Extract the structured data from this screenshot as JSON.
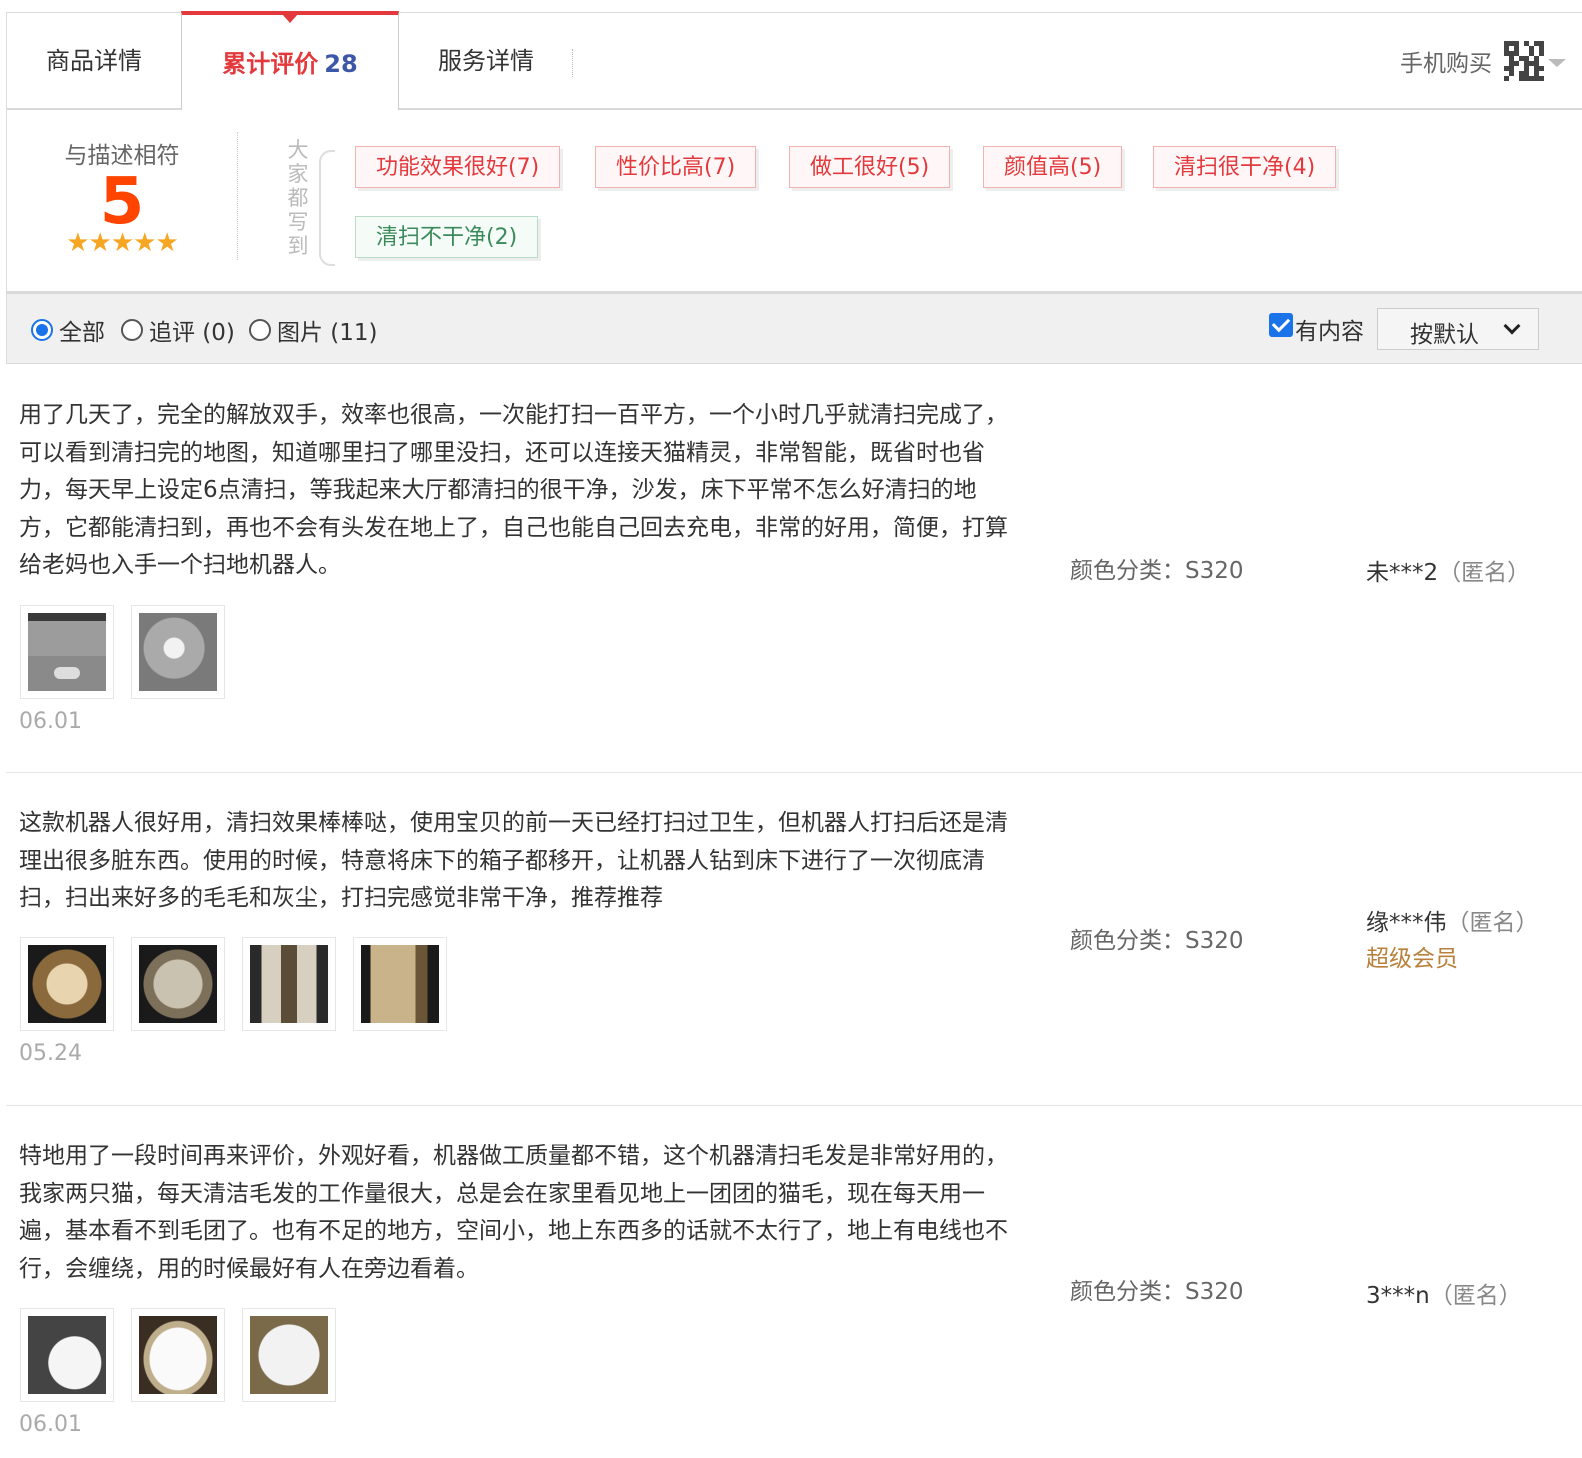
{
  "tabs": [
    {
      "label": "商品详情"
    },
    {
      "label": "累计评价",
      "count": "28"
    },
    {
      "label": "服务详情"
    }
  ],
  "mobile_buy": {
    "label": "手机购买",
    "icon": "qr-code-icon"
  },
  "rating": {
    "label": "与描述相符",
    "score": "5",
    "stars": "★★★★★",
    "everyone_wrote": "大家都写到"
  },
  "tags": [
    {
      "text": "功能效果很好(7)",
      "sentiment": "positive"
    },
    {
      "text": "性价比高(7)",
      "sentiment": "positive"
    },
    {
      "text": "做工很好(5)",
      "sentiment": "positive"
    },
    {
      "text": "颜值高(5)",
      "sentiment": "positive"
    },
    {
      "text": "清扫很干净(4)",
      "sentiment": "positive"
    },
    {
      "text": "清扫不干净(2)",
      "sentiment": "negative"
    }
  ],
  "filter": {
    "options": [
      {
        "label": "全部",
        "selected": true
      },
      {
        "label": "追评 (0)",
        "selected": false
      },
      {
        "label": "图片 (11)",
        "selected": false
      }
    ],
    "has_content": {
      "label": "有内容",
      "checked": true
    },
    "sort": {
      "label": "按默认"
    }
  },
  "reviews": [
    {
      "text": "用了几天了，完全的解放双手，效率也很高，一次能打扫一百平方，一个小时几乎就清扫完成了，可以看到清扫完的地图，知道哪里扫了哪里没扫，还可以连接天猫精灵，非常智能，既省时也省力，每天早上设定6点清扫，等我起来大厅都清扫的很干净，沙发，床下平常不怎么好清扫的地方，它都能清扫到，再也不会有头发在地上了，自己也能自己回去充电，非常的好用，简便，打算给老妈也入手一个扫地机器人。",
      "images": 2,
      "date": "06.01",
      "sku": "颜色分类：S320",
      "user": "未***2",
      "anon": "（匿名）"
    },
    {
      "text": "这款机器人很好用，清扫效果棒棒哒，使用宝贝的前一天已经打扫过卫生，但机器人打扫后还是清理出很多脏东西。使用的时候，特意将床下的箱子都移开，让机器人钻到床下进行了一次彻底清扫，扫出来好多的毛毛和灰尘，打扫完感觉非常干净，推荐推荐",
      "images": 4,
      "date": "05.24",
      "sku": "颜色分类：S320",
      "user": "缘***伟",
      "anon": "（匿名）",
      "vip": "超级会员"
    },
    {
      "text": "特地用了一段时间再来评价，外观好看，机器做工质量都不错，这个机器清扫毛发是非常好用的，我家两只猫，每天清洁毛发的工作量很大，总是会在家里看见地上一团团的猫毛，现在每天用一遍，基本看不到毛团了。也有不足的地方，空间小，地上东西多的话就不太行了，地上有电线也不行，会缠绕，用的时候最好有人在旁边看着。",
      "images": 3,
      "date": "06.01",
      "sku": "颜色分类：S320",
      "user": "3***n",
      "anon": "（匿名）"
    }
  ]
}
